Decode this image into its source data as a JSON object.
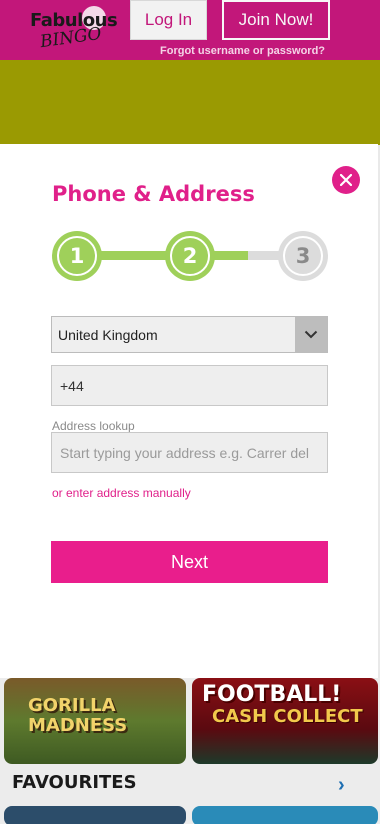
{
  "header": {
    "logo_main": "Fabulous",
    "logo_sub": "BINGO",
    "login_label": "Log In",
    "join_label": "Join Now!",
    "forgot_label": "Forgot username or password?"
  },
  "modal": {
    "title": "Phone & Address",
    "close_icon": "close-icon",
    "steps": [
      {
        "number": "1",
        "state": "done"
      },
      {
        "number": "2",
        "state": "current"
      },
      {
        "number": "3",
        "state": "todo"
      }
    ],
    "country": {
      "selected": "United Kingdom"
    },
    "phone": {
      "value": "+44"
    },
    "address": {
      "label": "Address lookup",
      "placeholder": "Start typing your address e.g. Carrer del"
    },
    "manual_link": "or enter address manually",
    "next_label": "Next"
  },
  "background": {
    "tile1_title": "GORILLA MADNESS",
    "tile2_title": "FOOTBALL!",
    "tile2_subtitle": "CASH COLLECT",
    "favourites_title": "FAVOURITES"
  },
  "colors": {
    "brand_pink": "#e0208a",
    "header_magenta": "#c2177a",
    "step_green": "#9fd05a",
    "olive_banner": "#9a9a02"
  }
}
